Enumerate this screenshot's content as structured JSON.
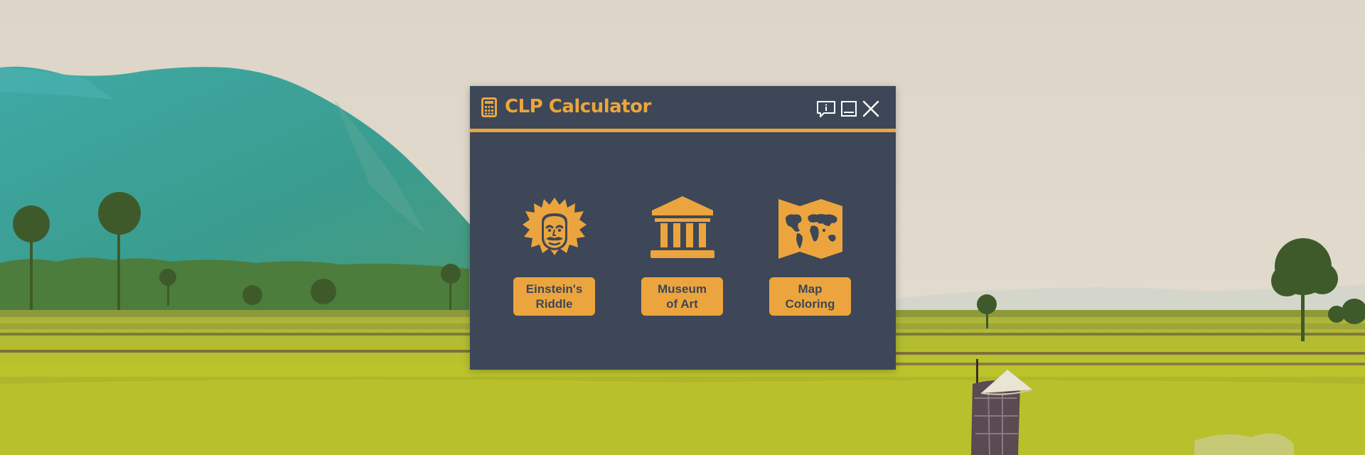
{
  "app": {
    "title": "CLP Calculator",
    "icon": "calculator-icon"
  },
  "window_controls": [
    {
      "name": "about",
      "icon": "info-speech-icon"
    },
    {
      "name": "minimize",
      "icon": "minimize-icon"
    },
    {
      "name": "close",
      "icon": "close-icon"
    }
  ],
  "launchers": [
    {
      "icon": "einstein-icon",
      "label_line1": "Einstein's",
      "label_line2": "Riddle"
    },
    {
      "icon": "museum-icon",
      "label_line1": "Museum",
      "label_line2": "of Art"
    },
    {
      "icon": "world-map-icon",
      "label_line1": "Map",
      "label_line2": "Coloring"
    }
  ],
  "colors": {
    "accent": "#eca53e",
    "window_background": "#3d4757",
    "desktop_sky": "#ddd6c9",
    "mountain": "#3a9e96",
    "field": "#b9c12a"
  },
  "wallpaper": "rice-field-landscape"
}
